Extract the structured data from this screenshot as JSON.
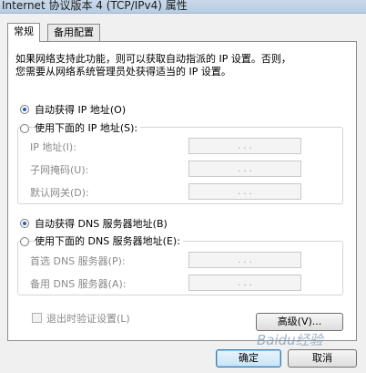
{
  "window": {
    "title": "Internet 协议版本 4 (TCP/IPv4) 属性"
  },
  "tabs": [
    {
      "label": "常规",
      "active": true
    },
    {
      "label": "备用配置",
      "active": false
    }
  ],
  "description": {
    "line1": "如果网络支持此功能，则可以获取自动指派的 IP 设置。否则，",
    "line2": "您需要从网络系统管理员处获得适当的 IP 设置。"
  },
  "ip": {
    "auto_label": "自动获得 IP 地址(O)",
    "auto_selected": true,
    "manual_label": "使用下面的 IP 地址(S):",
    "manual_selected": false,
    "fields": [
      {
        "label": "IP 地址(I):",
        "value": ". . ."
      },
      {
        "label": "子网掩码(U):",
        "value": ". . ."
      },
      {
        "label": "默认网关(D):",
        "value": ". . ."
      }
    ]
  },
  "dns": {
    "auto_label": "自动获得 DNS 服务器地址(B)",
    "auto_selected": true,
    "manual_label": "使用下面的 DNS 服务器地址(E):",
    "manual_selected": false,
    "fields": [
      {
        "label": "首选 DNS 服务器(P):",
        "value": ". . ."
      },
      {
        "label": "备用 DNS 服务器(A):",
        "value": ". . ."
      }
    ]
  },
  "validate": {
    "label": "退出时验证设置(L)",
    "checked": false
  },
  "buttons": {
    "advanced": "高级(V)...",
    "ok": "确定",
    "cancel": "取消"
  },
  "watermark": "Baidu经验"
}
